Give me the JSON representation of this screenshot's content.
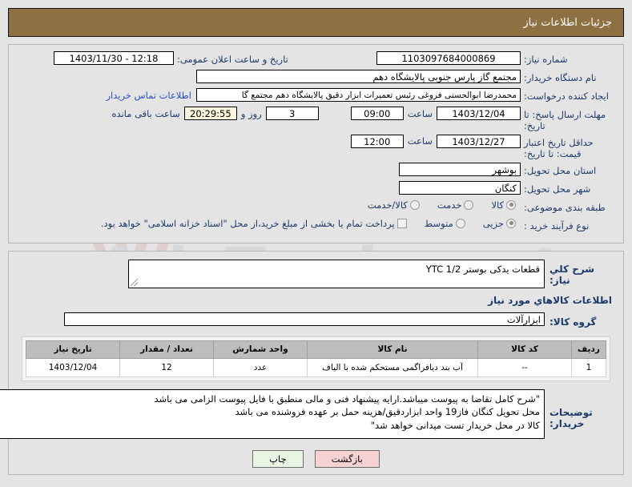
{
  "header": {
    "title": "جزئیات اطلاعات نیاز"
  },
  "form": {
    "need_number_label": "شماره نیاز:",
    "need_number_value": "1103097684000869",
    "announce_datetime_label": "تاریخ و ساعت اعلان عمومی:",
    "announce_datetime_value": "12:18 - 1403/11/30",
    "buyer_org_label": "نام دستگاه خریدار:",
    "buyer_org_value": "مجتمع گاز پارس جنوبی  پالایشگاه دهم",
    "creator_label": "ایجاد کننده درخواست:",
    "creator_value": "محمدرضا ابوالحسنی فروغی رئیس تعمیرات ابزار دقیق پالایشگاه دهم  مجتمع گا",
    "contact_link": "اطلاعات تماس خریدار",
    "deadline_label": "مهلت ارسال پاسخ: تا تاریخ:",
    "deadline_date": "1403/12/04",
    "hour_label": "ساعت",
    "deadline_hour": "09:00",
    "remaining_days": "3",
    "days_and_label": "روز و",
    "remaining_time": "20:29:55",
    "remaining_suffix": "ساعت باقی مانده",
    "price_validity_label": "حداقل تاریخ اعتبار قیمت: تا تاریخ:",
    "price_validity_date": "1403/12/27",
    "price_validity_hour": "12:00",
    "province_label": "استان محل تحویل:",
    "province_value": "بوشهر",
    "city_label": "شهر محل تحویل:",
    "city_value": "کنگان",
    "category_label": "طبقه بندی موضوعی:",
    "category_options": [
      "کالا",
      "خدمت",
      "کالا/خدمت"
    ],
    "category_selected": "کالا",
    "process_label": "نوع فرآیند خرید :",
    "process_options": [
      "جزیی",
      "متوسط"
    ],
    "process_selected": "جزیی",
    "treasury_checkbox_label": "پرداخت تمام یا بخشی از مبلغ خرید،از محل \"اسناد خزانه اسلامی\" خواهد بود.",
    "treasury_checked": false
  },
  "description": {
    "label": "شرح كلي نياز:",
    "value": "قطعات یدکی بوستر YTC 1/2"
  },
  "goods_section": {
    "title": "اطلاعات كالاهاي مورد نياز",
    "group_label": "گروه کالا:",
    "group_value": "ابزارآلات"
  },
  "table": {
    "columns": [
      "ردیف",
      "کد کالا",
      "نام کالا",
      "واحد شمارش",
      "تعداد / مقدار",
      "تاریخ نیاز"
    ],
    "rows": [
      {
        "row": "1",
        "code": "--",
        "name": "آب بند دیافراگمی مستحکم شده با الیاف",
        "unit": "عدد",
        "qty": "12",
        "date": "1403/12/04"
      }
    ]
  },
  "notes": {
    "label": "توضیحات خریدار:",
    "value": "\"شرح کامل تقاضا به پیوست میباشد.ارایه پیشنهاد فنی و مالی منطبق با فایل پیوست الزامی می باشد\nمحل تحویل کنگان فاز19 واحد ابزاردقیق/هزینه حمل بر عهده فروشنده می باشد\nکالا در محل خریدار تست میدانی خواهد شد\""
  },
  "buttons": {
    "print": "چاپ",
    "back": "بازگشت"
  },
  "watermark": {
    "text": "AriaTender.net"
  }
}
